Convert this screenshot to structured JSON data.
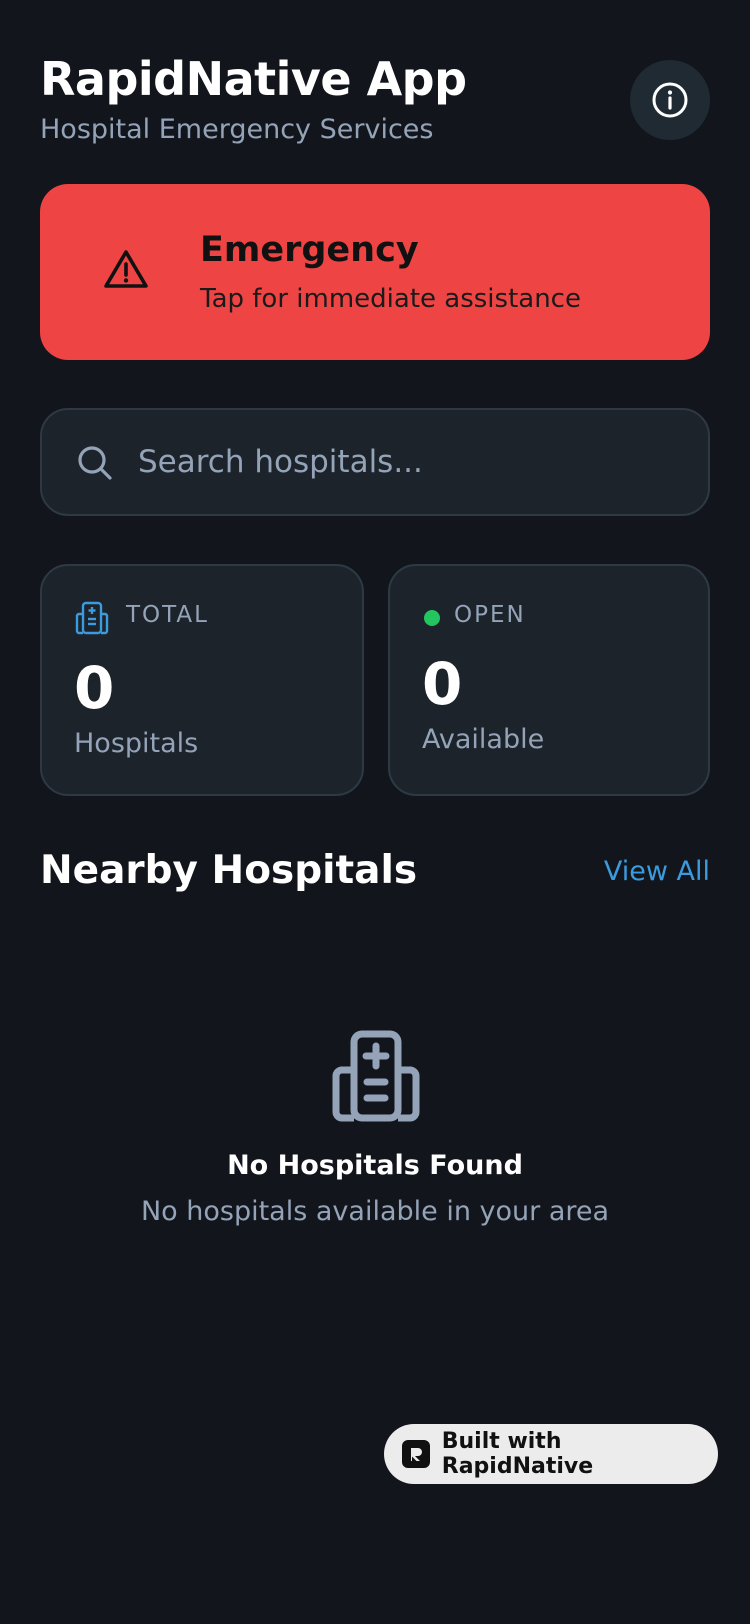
{
  "header": {
    "title": "RapidNative App",
    "subtitle": "Hospital Emergency Services",
    "info_icon": "info-circle-icon"
  },
  "emergency": {
    "title": "Emergency",
    "subtitle": "Tap for immediate assistance",
    "icon": "warning-triangle-icon",
    "background_color": "#ef4444"
  },
  "search": {
    "placeholder": "Search hospitals...",
    "value": ""
  },
  "stats": {
    "total": {
      "label": "TOTAL",
      "value": "0",
      "caption": "Hospitals",
      "icon": "hospital-icon"
    },
    "open": {
      "label": "OPEN",
      "value": "0",
      "caption": "Available",
      "status_color": "#22c55e"
    }
  },
  "nearby": {
    "title": "Nearby Hospitals",
    "view_all_label": "View All",
    "empty_title": "No Hospitals Found",
    "empty_subtitle": "No hospitals available in your area",
    "empty_icon": "hospital-icon"
  },
  "badge": {
    "label": "Built with RapidNative"
  },
  "colors": {
    "background": "#12161c",
    "accent_link": "#3b9bdd",
    "muted_text": "#94a3b8"
  }
}
